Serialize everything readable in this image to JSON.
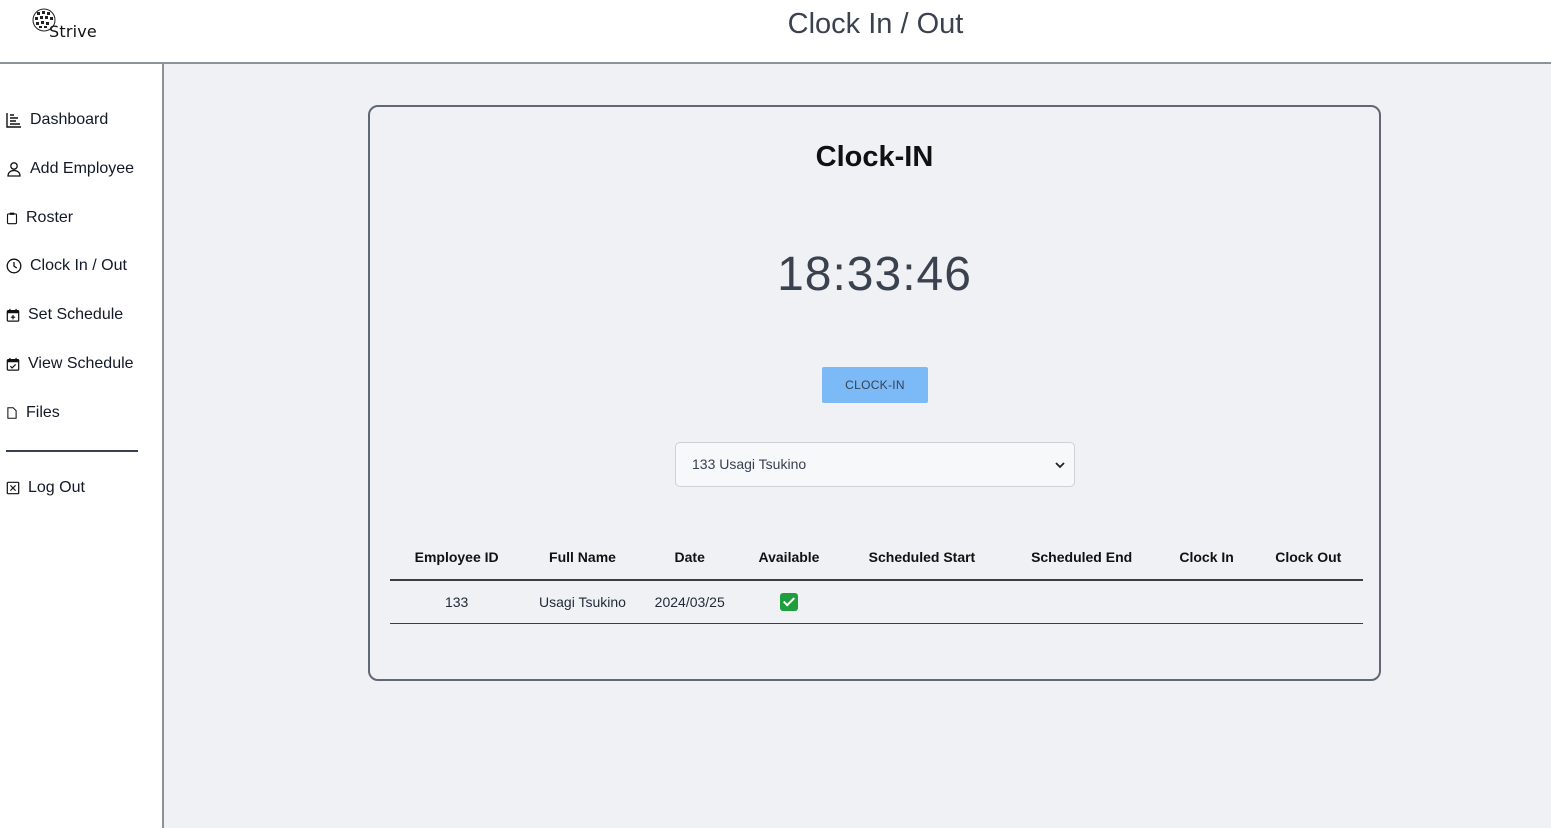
{
  "header": {
    "brand": "Strive",
    "title": "Clock In / Out"
  },
  "sidebar": {
    "items": [
      {
        "label": "Dashboard",
        "icon": "bar-chart-icon"
      },
      {
        "label": "Add Employee",
        "icon": "person-icon"
      },
      {
        "label": "Roster",
        "icon": "clipboard-icon"
      },
      {
        "label": "Clock In / Out",
        "icon": "clock-icon"
      },
      {
        "label": "Set Schedule",
        "icon": "calendar-plus-icon"
      },
      {
        "label": "View Schedule",
        "icon": "calendar-check-icon"
      },
      {
        "label": "Files",
        "icon": "file-icon"
      }
    ],
    "logout": {
      "label": "Log Out",
      "icon": "x-square-icon"
    }
  },
  "main": {
    "card_title": "Clock-IN",
    "time": "18:33:46",
    "button_label": "CLOCK-IN",
    "button_color": "#7cbaf7",
    "employee_select": {
      "selected": "133 Usagi Tsukino"
    },
    "table": {
      "headers": [
        "Employee ID",
        "Full Name",
        "Date",
        "Available",
        "Scheduled Start",
        "Scheduled End",
        "Clock In",
        "Clock Out"
      ],
      "rows": [
        {
          "employee_id": "133",
          "full_name": "Usagi Tsukino",
          "date": "2024/03/25",
          "available": true,
          "scheduled_start": "",
          "scheduled_end": "",
          "clock_in": "",
          "clock_out": ""
        }
      ]
    }
  }
}
